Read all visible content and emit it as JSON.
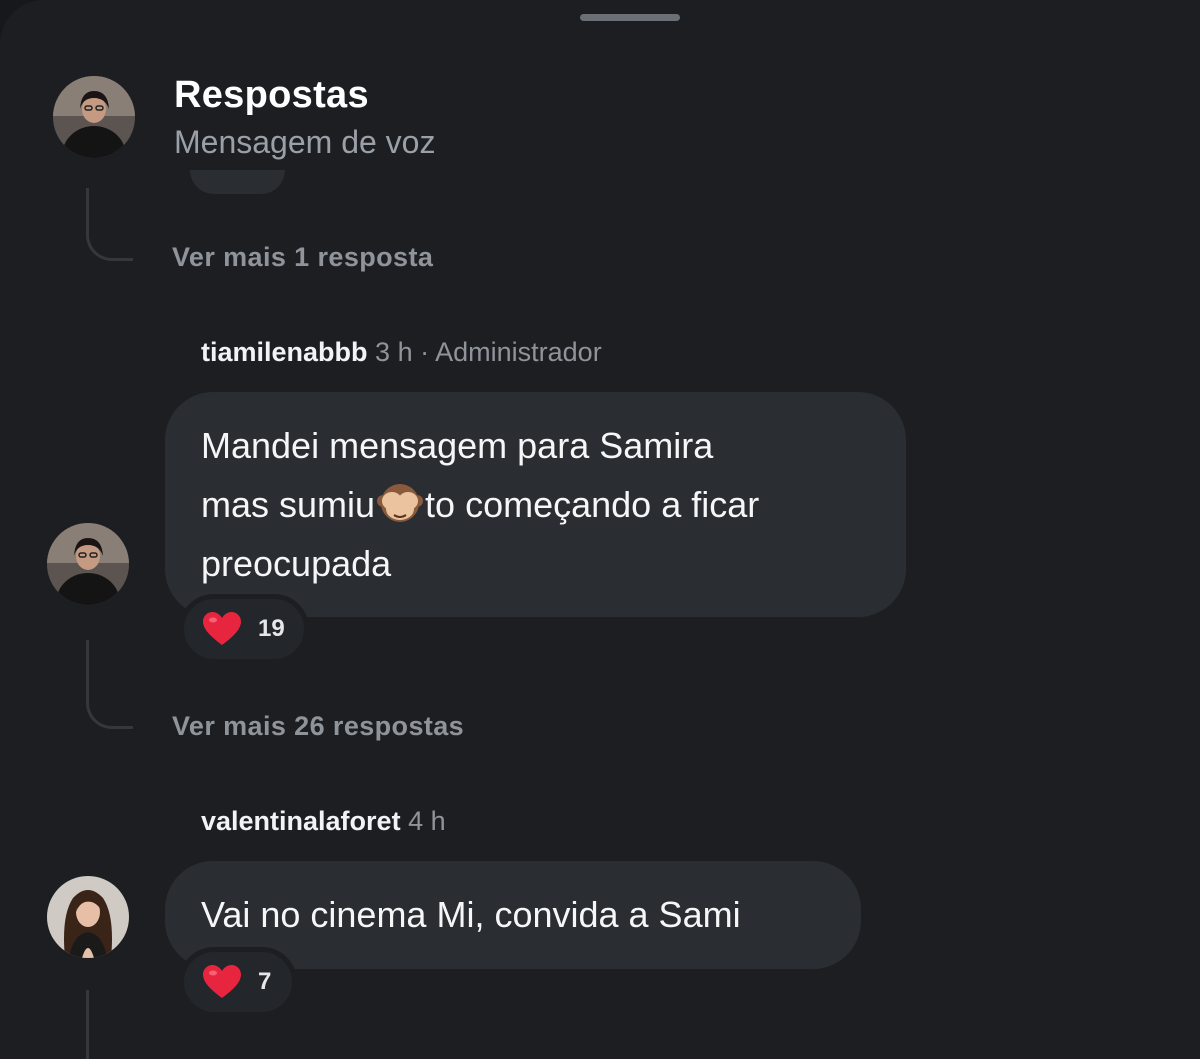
{
  "header": {
    "title": "Respostas",
    "subtitle": "Mensagem de voz"
  },
  "thread": {
    "more_replies_1": "Ver mais 1 resposta",
    "more_replies_2": "Ver mais 26 respostas"
  },
  "comments": [
    {
      "username": "tiamilenabbb",
      "time": "3 h",
      "separator": "·",
      "role": "Administrador",
      "text_line1": "Mandei mensagem para Samira",
      "text_line2a": "mas sumiu",
      "text_emoji": "see-no-evil-monkey",
      "text_line2b": "to começando a ficar",
      "text_line3": "preocupada",
      "reaction_icon": "heart-icon",
      "reaction_count": "19"
    },
    {
      "username": "valentinalaforet",
      "time": "4 h",
      "text": "Vai no cinema Mi, convida a Sami",
      "reaction_icon": "heart-icon",
      "reaction_count": "7"
    }
  ],
  "colors": {
    "background": "#1c1e22",
    "bubble": "#2a2d31",
    "muted_text": "#8f949b",
    "heart": "#e8253f"
  }
}
